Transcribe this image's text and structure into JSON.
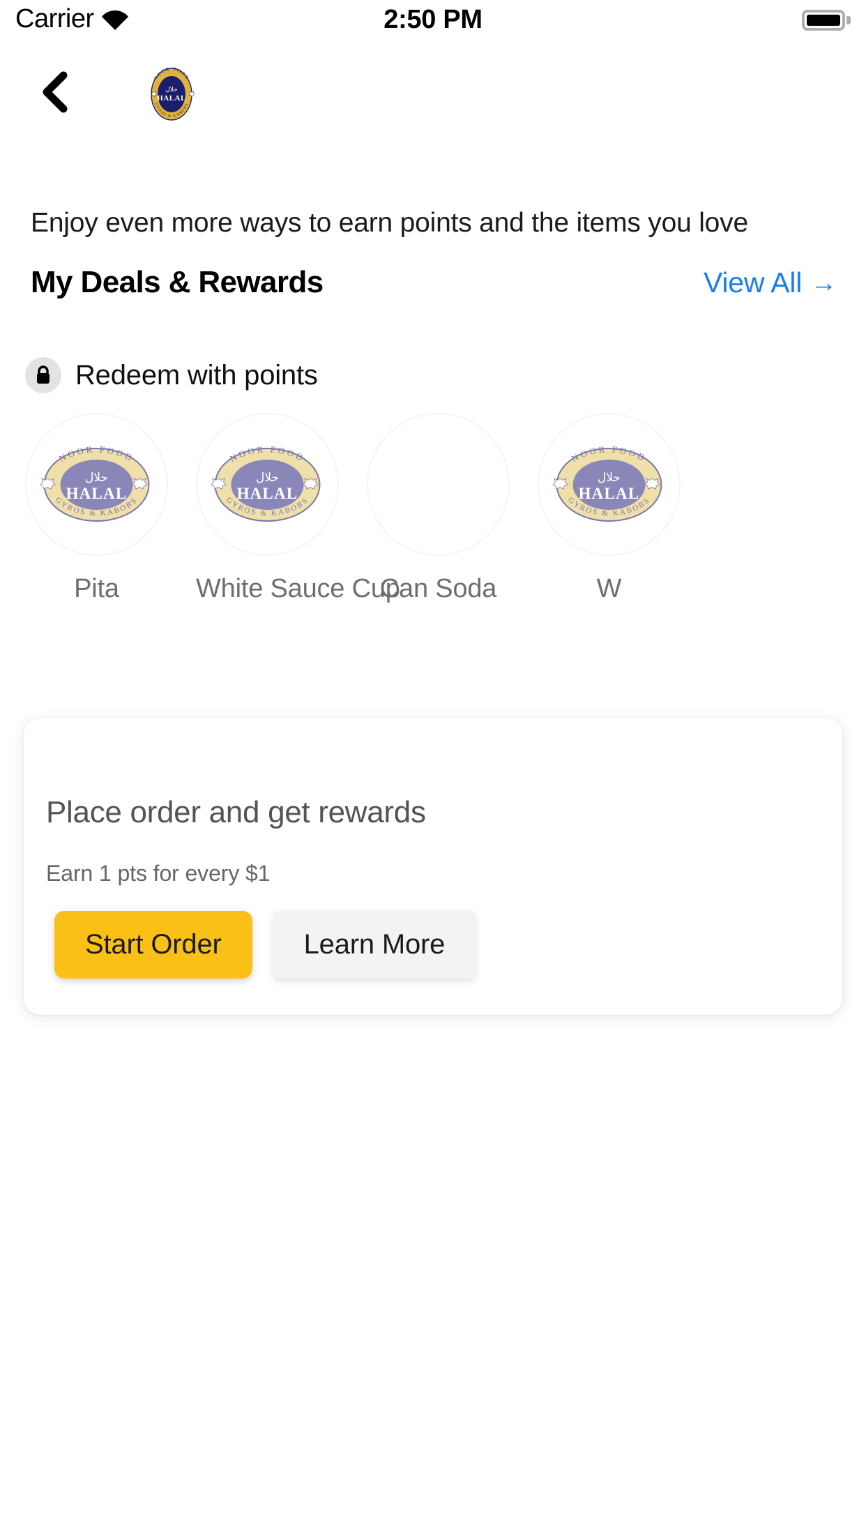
{
  "status_bar": {
    "carrier": "Carrier",
    "time": "2:50 PM",
    "wifi_icon": "wifi-icon",
    "battery_icon": "battery-full-icon"
  },
  "nav": {
    "back_icon": "chevron-left-icon",
    "brand_logo_icon": "noor-food-halal-logo-icon",
    "brand_name": "NOOR FOOD",
    "brand_center_top": "حلال",
    "brand_center_main": "HALAL",
    "brand_bottom": "GYROS & KABOBS"
  },
  "header": {
    "subtitle": "Enjoy even more ways to earn points and the items you love",
    "section_title": "My Deals & Rewards",
    "view_all_label": "View All",
    "view_all_arrow": "→"
  },
  "redeem": {
    "lock_icon": "lock-icon",
    "label": "Redeem with points"
  },
  "rewards": [
    {
      "name": "Pita",
      "has_image": true
    },
    {
      "name": "White Sauce Cup",
      "has_image": true
    },
    {
      "name": "Can Soda",
      "has_image": false
    },
    {
      "name": "W",
      "has_image": true
    }
  ],
  "promo_card": {
    "title": "Place order and get rewards",
    "subtitle": "Earn 1 pts for every $1",
    "primary_button": "Start Order",
    "secondary_button": "Learn More"
  },
  "colors": {
    "accent_blue": "#1a7feb",
    "primary_button": "#fbc016",
    "secondary_button": "#f1f3f5",
    "logo_gold": "#e8b càng",
    "logo_navy": "#1b1f6b",
    "faded_cream": "#efdfa8",
    "faded_purple": "#8a86b8"
  }
}
